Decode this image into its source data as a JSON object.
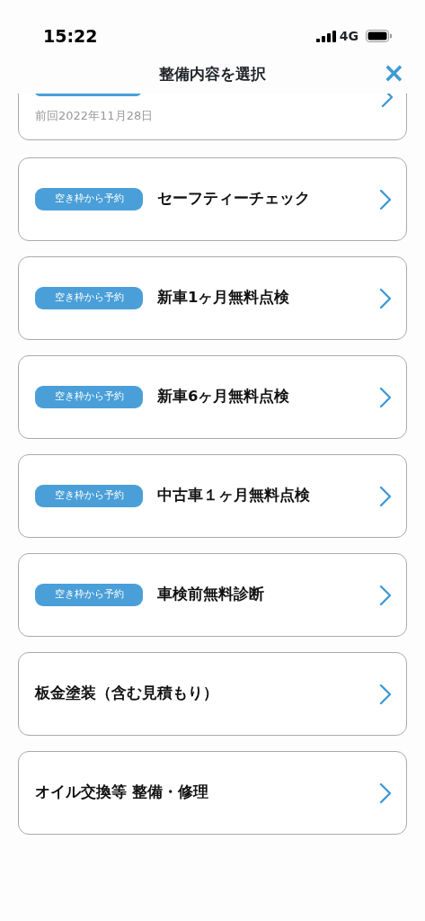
{
  "status_bar": {
    "time": "15:22",
    "network": "4G"
  },
  "header": {
    "title": "整備内容を選択",
    "close": "×"
  },
  "partial_item": {
    "last_visit": "前回2022年11月28日"
  },
  "services": [
    {
      "kind": "slot",
      "badge": "空き枠から予約",
      "title": "セーフティーチェック"
    },
    {
      "kind": "slot",
      "badge": "空き枠から予約",
      "title": "新車1ヶ月無料点検"
    },
    {
      "kind": "slot",
      "badge": "空き枠から予約",
      "title": "新車6ヶ月無料点検"
    },
    {
      "kind": "slot",
      "badge": "空き枠から予約",
      "title": "中古車１ヶ月無料点検"
    },
    {
      "kind": "slot",
      "badge": "空き枠から予約",
      "title": "車検前無料診断"
    },
    {
      "kind": "plain",
      "title": "板金塗装（含む見積もり）"
    },
    {
      "kind": "plain",
      "title": "オイル交換等 整備・修理"
    }
  ]
}
